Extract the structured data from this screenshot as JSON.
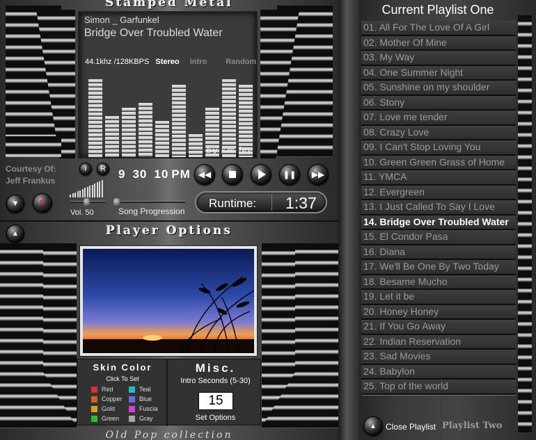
{
  "header": {
    "title": "Stamped Metal"
  },
  "now_playing": {
    "artist": "Simon _ Garfunkel",
    "song": "Bridge Over Troubled Water",
    "audio_info": "44.1khz /128KBPS",
    "channel": "Stereo",
    "intro_label": "Intro",
    "random_label": "Random",
    "signature": "by km lee",
    "equalizer_levels": [
      0.95,
      0.5,
      0.6,
      0.66,
      0.44,
      0.88,
      0.28,
      0.6,
      0.95,
      0.88
    ]
  },
  "courtesy": {
    "line1": "Courtesy Of:",
    "line2": "Jeff Frankus"
  },
  "clock": {
    "hour": "9",
    "minute": "30",
    "hour2": "10",
    "ampm": "PM"
  },
  "buttons": {
    "i_label": "I",
    "r_label": "R",
    "p_label": "P"
  },
  "volume": {
    "label": "Vol. 50",
    "value": 50
  },
  "progress": {
    "label": "Song Progression",
    "value": 0
  },
  "runtime": {
    "label": "Runtime:",
    "value": "1:37"
  },
  "options": {
    "title": "Player Options",
    "skin_title": "Skin Color",
    "skin_subtitle": "Click To Set",
    "skins": [
      {
        "name": "Red",
        "color": "#d93030"
      },
      {
        "name": "Teal",
        "color": "#1fbfbf"
      },
      {
        "name": "Copper",
        "color": "#c8642a"
      },
      {
        "name": "Blue",
        "color": "#6a6ae8"
      },
      {
        "name": "Gold",
        "color": "#d8a020"
      },
      {
        "name": "Fuscia",
        "color": "#d83cd8"
      },
      {
        "name": "Green",
        "color": "#2ac02a"
      },
      {
        "name": "Gray",
        "color": "#a8a8a8"
      }
    ],
    "misc_title": "Misc.",
    "misc_subtitle": "Intro Seconds (5-30)",
    "intro_seconds": "15",
    "set_options": "Set Options"
  },
  "footer": {
    "collection": "Old Pop collection"
  },
  "playlist": {
    "title": "Current Playlist One",
    "active_index": 13,
    "tracks": [
      "01. All For The Love Of A Girl",
      "02. Mother Of Mine",
      "03. My Way",
      "04. One Summer Night",
      "05. Sunshine on my shoulder",
      "06. Stony",
      "07. Love me tender",
      "08. Crazy Love",
      "09. I Can't Stop Loving You",
      "10. Green Green Grass of Home",
      "11. YMCA",
      "12. Evergreen",
      "13. I Just Called To Say I Love",
      "14. Bridge Over Troubled Water",
      "15. El Condor Pasa",
      "16. Diana",
      "17. We'll Be One By Two Today",
      "18. Besame Mucho",
      "19. Let it be",
      "20. Honey Honey",
      "21. If You Go Away",
      "22. Indian Reservation",
      "23. Sad Movies",
      "24. Babylon",
      "25. Top of the world"
    ],
    "close_label": "Close Playlist",
    "playlist_two_label": "Playlist Two"
  }
}
